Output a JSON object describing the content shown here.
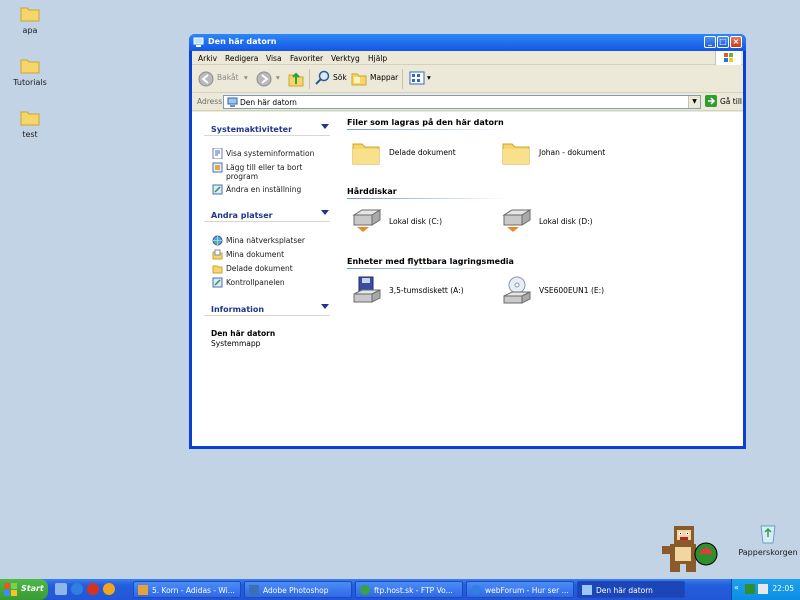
{
  "desktop": {
    "icons": [
      {
        "label": "apa"
      },
      {
        "label": "Tutorials"
      },
      {
        "label": "test"
      },
      {
        "label": "Papperskorgen"
      }
    ]
  },
  "window": {
    "title": "Den här datorn",
    "menu": [
      "Arkiv",
      "Redigera",
      "Visa",
      "Favoriter",
      "Verktyg",
      "Hjälp"
    ],
    "toolbar": {
      "back": "Bakåt",
      "search": "Sök",
      "folders": "Mappar"
    },
    "address": {
      "label": "Adress",
      "value": "Den här datorn",
      "go": "Gå till"
    },
    "left_pane": {
      "system_tasks": {
        "title": "Systemaktiviteter",
        "items": [
          "Visa systeminformation",
          "Lägg till eller ta bort program",
          "Ändra en inställning"
        ]
      },
      "other_places": {
        "title": "Andra platser",
        "items": [
          "Mina nätverksplatser",
          "Mina dokument",
          "Delade dokument",
          "Kontrollpanelen"
        ]
      },
      "details": {
        "title": "Information",
        "name": "Den här datorn",
        "type": "Systemmapp"
      }
    },
    "groups": {
      "files": {
        "title": "Filer som lagras på den här datorn",
        "items": [
          "Delade dokument",
          "Johan - dokument"
        ]
      },
      "hard_drives": {
        "title": "Hårddiskar",
        "items": [
          "Lokal disk (C:)",
          "Lokal disk (D:)"
        ]
      },
      "removable": {
        "title": "Enheter med flyttbara lagringsmedia",
        "items": [
          "3,5-tumsdiskett (A:)",
          "VSE600EUN1 (E:)"
        ]
      }
    }
  },
  "taskbar": {
    "start": "Start",
    "tasks": [
      "5. Korn - Adidas - Wi...",
      "Adobe Photoshop",
      "ftp.host.sk - FTP Vo...",
      "webForum - Hur ser ...",
      "Den här datorn"
    ],
    "clock": "22:05"
  },
  "colors": {
    "desktop_bg": "#c3d3e6",
    "title_blue": "#1456e6",
    "taskbar_blue": "#245edb",
    "start_green": "#3a9a33",
    "panel_title": "#21358c"
  }
}
